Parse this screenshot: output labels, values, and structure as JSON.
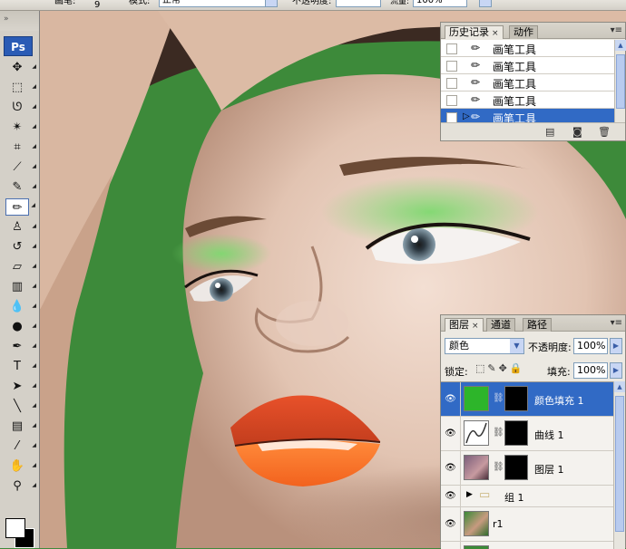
{
  "options_bar": {
    "brush_label": "画笔:",
    "brush_size": "9",
    "mode_label": "模式:",
    "mode_value": "正常",
    "opacity_label": "不透明度:",
    "opacity_value": "",
    "flow_label": "流量:",
    "flow_value": "100%"
  },
  "toolbox": {
    "logo": "Ps",
    "grip": "»",
    "tools": [
      {
        "name": "move-tool",
        "glyph": "✥"
      },
      {
        "name": "marquee-tool",
        "glyph": "⬚"
      },
      {
        "name": "lasso-tool",
        "glyph": "ᘎ"
      },
      {
        "name": "magic-wand-tool",
        "glyph": "✴"
      },
      {
        "name": "crop-tool",
        "glyph": "⌗"
      },
      {
        "name": "slice-tool",
        "glyph": "⟋"
      },
      {
        "name": "healing-brush-tool",
        "glyph": "✎"
      },
      {
        "name": "brush-tool",
        "glyph": "✏",
        "active": true
      },
      {
        "name": "clone-stamp-tool",
        "glyph": "♙"
      },
      {
        "name": "history-brush-tool",
        "glyph": "↺"
      },
      {
        "name": "eraser-tool",
        "glyph": "▱"
      },
      {
        "name": "gradient-tool",
        "glyph": "▥"
      },
      {
        "name": "blur-tool",
        "glyph": "💧"
      },
      {
        "name": "dodge-tool",
        "glyph": "●"
      },
      {
        "name": "pen-tool",
        "glyph": "✒"
      },
      {
        "name": "type-tool",
        "glyph": "T"
      },
      {
        "name": "path-selection-tool",
        "glyph": "➤"
      },
      {
        "name": "line-tool",
        "glyph": "╲"
      },
      {
        "name": "notes-tool",
        "glyph": "▤"
      },
      {
        "name": "eyedropper-tool",
        "glyph": "⁄"
      },
      {
        "name": "hand-tool",
        "glyph": "✋"
      },
      {
        "name": "zoom-tool",
        "glyph": "⚲"
      }
    ]
  },
  "history_panel": {
    "tab_history": "历史记录",
    "tab_actions": "动作",
    "close": "×",
    "items": [
      {
        "label": "画笔工具",
        "selected": false
      },
      {
        "label": "画笔工具",
        "selected": false
      },
      {
        "label": "画笔工具",
        "selected": false
      },
      {
        "label": "画笔工具",
        "selected": false
      },
      {
        "label": "画笔工具",
        "selected": true
      }
    ]
  },
  "layers_panel": {
    "tab_layers": "图层",
    "tab_channels": "通道",
    "tab_paths": "路径",
    "close": "×",
    "blend_mode": "颜色",
    "opacity_label": "不透明度:",
    "opacity_value": "100%",
    "lock_label": "锁定:",
    "fill_label": "填充:",
    "fill_value": "100%",
    "layers": [
      {
        "name": "颜色填充 1",
        "selected": true
      },
      {
        "name": "曲线 1",
        "selected": false
      },
      {
        "name": "图层 1",
        "selected": false
      },
      {
        "name": "组 1",
        "selected": false
      },
      {
        "name": "r1",
        "selected": false
      }
    ]
  },
  "colors": {
    "selection": "#316ac5",
    "fill_layer_green": "#2db52a",
    "background_green": "#3d8a3a"
  }
}
